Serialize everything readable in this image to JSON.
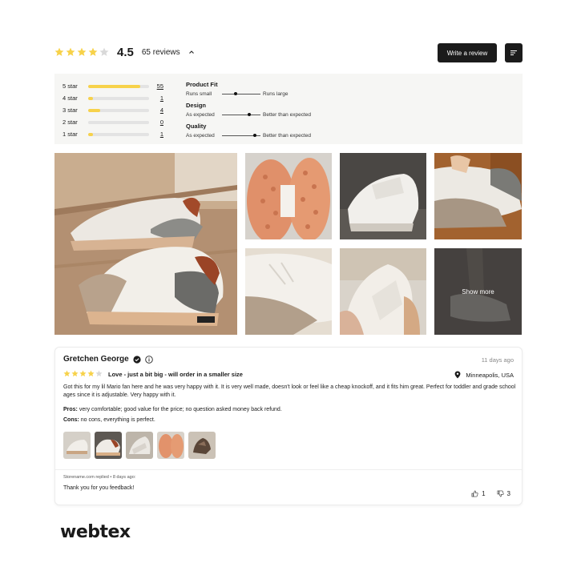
{
  "header": {
    "rating_value": "4.5",
    "rating_fraction": 0.8,
    "reviews_label": "65 reviews",
    "write_review_label": "Write a review",
    "star_color": "#f7d24a",
    "star_empty_color": "#d9d9d9"
  },
  "distribution": [
    {
      "label": "5 star",
      "count": "55",
      "fraction": 0.85
    },
    {
      "label": "4 star",
      "count": "1",
      "fraction": 0.08
    },
    {
      "label": "3 star",
      "count": "4",
      "fraction": 0.2
    },
    {
      "label": "2 star",
      "count": "0",
      "fraction": 0.0
    },
    {
      "label": "1 star",
      "count": "1",
      "fraction": 0.08
    }
  ],
  "fit": [
    {
      "title": "Product Fit",
      "left": "Runs small",
      "right": "Runs large",
      "value": 0.35
    },
    {
      "title": "Design",
      "left": "As expected",
      "right": "Better than expected",
      "value": 0.7
    },
    {
      "title": "Quality",
      "left": "As expected",
      "right": "Better than expected",
      "value": 0.85
    }
  ],
  "gallery": {
    "show_more_label": "Show more"
  },
  "review": {
    "name": "Gretchen George",
    "date": "11 days ago",
    "stars": 4,
    "title": "Love - just a bit big - will order in a smaller size",
    "location": "Minneapolis, USA",
    "body": "Got this for my lil Mario fan here and he was very happy with it. It is very well made, doesn't look or feel like a cheap knockoff, and it fits him great. Perfect for toddler and grade school ages since it is adjustable. Very happy with it.",
    "pros_label": "Pros:",
    "pros_text": " very comfortable; good value for the price; no question asked money back refund.",
    "cons_label": "Cons:",
    "cons_text": " no cons, everything is perfect.",
    "reply_meta": "Storename.com replied • 8 days ago:",
    "reply_text": "Thank you for you feedback!",
    "upvotes": "1",
    "downvotes": "3"
  },
  "brand": {
    "name": "webtex"
  }
}
